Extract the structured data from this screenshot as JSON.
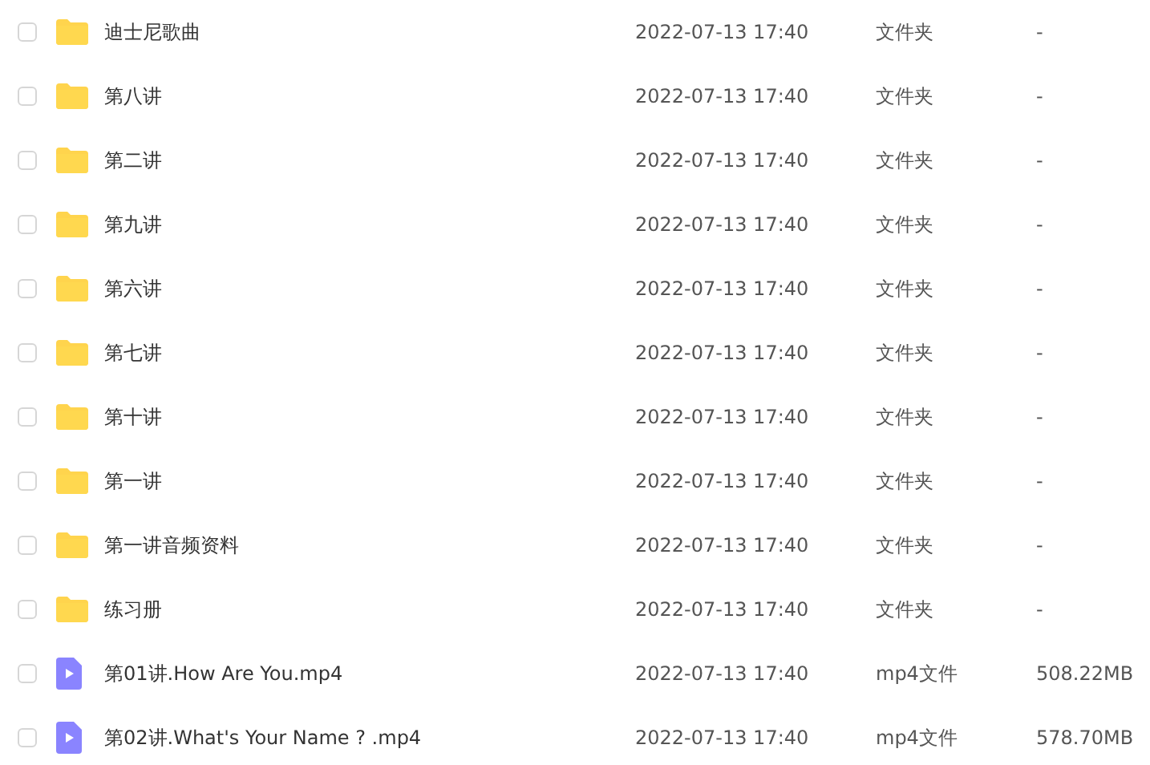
{
  "files": [
    {
      "kind": "folder",
      "checked": false,
      "name": "迪士尼歌曲",
      "modified": "2022-07-13 17:40",
      "type": "文件夹",
      "size": "-"
    },
    {
      "kind": "folder",
      "checked": false,
      "name": "第八讲",
      "modified": "2022-07-13 17:40",
      "type": "文件夹",
      "size": "-"
    },
    {
      "kind": "folder",
      "checked": false,
      "name": "第二讲",
      "modified": "2022-07-13 17:40",
      "type": "文件夹",
      "size": "-"
    },
    {
      "kind": "folder",
      "checked": false,
      "name": "第九讲",
      "modified": "2022-07-13 17:40",
      "type": "文件夹",
      "size": "-"
    },
    {
      "kind": "folder",
      "checked": false,
      "name": "第六讲",
      "modified": "2022-07-13 17:40",
      "type": "文件夹",
      "size": "-"
    },
    {
      "kind": "folder",
      "checked": false,
      "name": "第七讲",
      "modified": "2022-07-13 17:40",
      "type": "文件夹",
      "size": "-"
    },
    {
      "kind": "folder",
      "checked": false,
      "name": "第十讲",
      "modified": "2022-07-13 17:40",
      "type": "文件夹",
      "size": "-"
    },
    {
      "kind": "folder",
      "checked": false,
      "name": "第一讲",
      "modified": "2022-07-13 17:40",
      "type": "文件夹",
      "size": "-"
    },
    {
      "kind": "folder",
      "checked": false,
      "name": "第一讲音频资料",
      "modified": "2022-07-13 17:40",
      "type": "文件夹",
      "size": "-"
    },
    {
      "kind": "folder",
      "checked": false,
      "name": "练习册",
      "modified": "2022-07-13 17:40",
      "type": "文件夹",
      "size": "-"
    },
    {
      "kind": "video",
      "checked": false,
      "name": "第01讲.How Are You.mp4",
      "modified": "2022-07-13 17:40",
      "type": "mp4文件",
      "size": "508.22MB"
    },
    {
      "kind": "video",
      "checked": false,
      "name": "第02讲.What's Your Name ? .mp4",
      "modified": "2022-07-13 17:40",
      "type": "mp4文件",
      "size": "578.70MB"
    }
  ]
}
